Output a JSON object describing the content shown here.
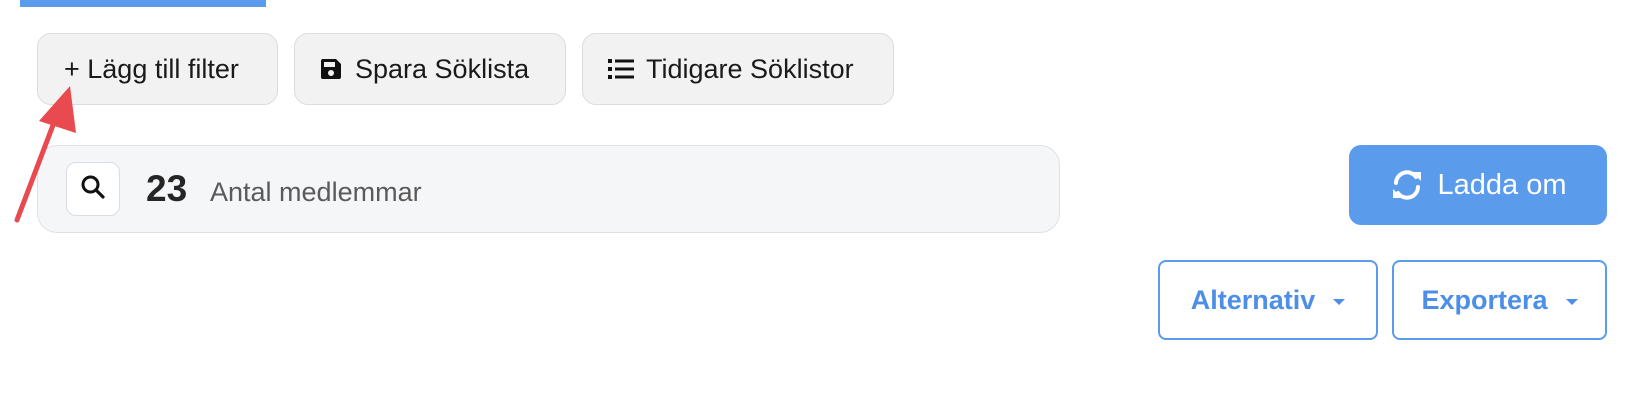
{
  "toolbar": {
    "add_filter": {
      "label": "+ Lägg till filter"
    },
    "save_list": {
      "label": "Spara Söklista",
      "icon": "floppy-disk-icon"
    },
    "previous_lists": {
      "label": "Tidigare Söklistor",
      "icon": "list-icon"
    }
  },
  "search": {
    "icon": "search-icon",
    "count": "23",
    "count_label": "Antal medlemmar"
  },
  "actions": {
    "reload": {
      "label": "Ladda om",
      "icon": "refresh-icon"
    },
    "alternativ": {
      "label": "Alternativ",
      "icon": "caret-down-icon"
    },
    "exportera": {
      "label": "Exportera",
      "icon": "caret-down-icon"
    }
  },
  "annotation": {
    "type": "arrow",
    "color": "#e84a4f",
    "points_to": "add-filter-button"
  },
  "colors": {
    "accent": "#5b9bec",
    "accent_text": "#4d8fe6",
    "annotation": "#e84a4f"
  }
}
